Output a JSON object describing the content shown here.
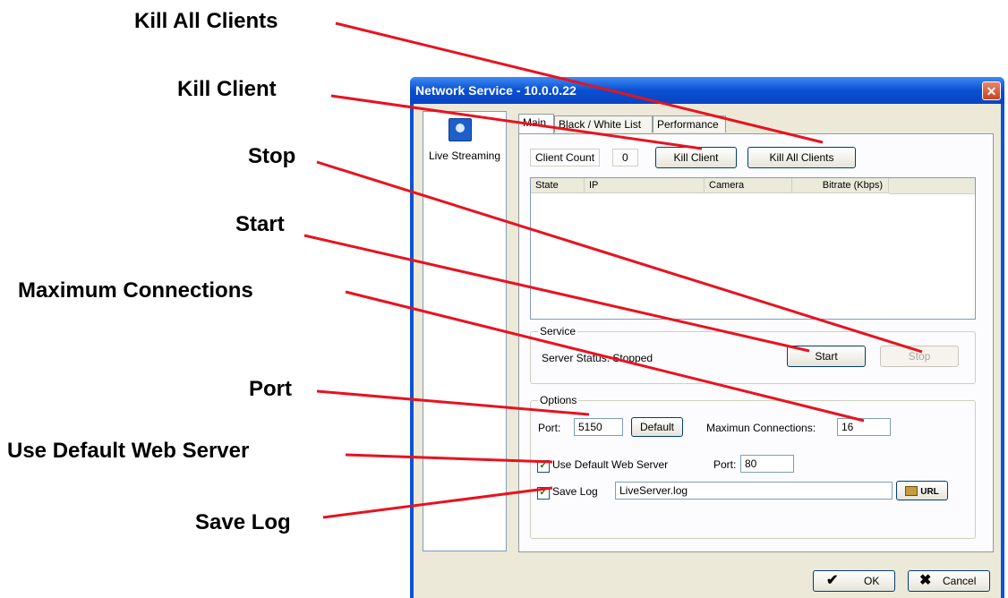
{
  "callouts": {
    "kill_all_clients": "Kill All Clients",
    "kill_client": "Kill Client",
    "stop": "Stop",
    "start": "Start",
    "max_connections": "Maximum Connections",
    "port": "Port",
    "use_default_web_server": "Use Default Web Server",
    "save_log": "Save Log",
    "line_color": "#e8121f"
  },
  "window": {
    "title": "Network Service - 10.0.0.22",
    "close_glyph": "✕"
  },
  "sidebar": {
    "item_label": "Live Streaming",
    "item_icon": "live-streaming-icon"
  },
  "tabs": [
    "Main",
    "Black / White List",
    "Performance"
  ],
  "main": {
    "client_count_label": "Client Count",
    "client_count_value": "0",
    "kill_client_button": "Kill Client",
    "kill_all_clients_button": "Kill All Clients",
    "columns": [
      "State",
      "IP",
      "Camera",
      "Bitrate (Kbps)"
    ],
    "service": {
      "group_label": "Service",
      "status_text": "Server Status: Stopped",
      "start_button": "Start",
      "stop_button": "Stop"
    },
    "options": {
      "group_label": "Options",
      "port_label": "Port:",
      "port_value": "5150",
      "default_button": "Default",
      "max_conn_label": "Maximun Connections:",
      "max_conn_value": "16",
      "use_default_web_server_label": "Use Default Web Server",
      "use_default_web_server_checked": true,
      "web_port_label": "Port:",
      "web_port_value": "80",
      "save_log_label": "Save Log",
      "save_log_checked": true,
      "log_file_value": "LiveServer.log",
      "url_button": "URL"
    }
  },
  "footer": {
    "ok_button": "OK",
    "cancel_button": "Cancel"
  }
}
